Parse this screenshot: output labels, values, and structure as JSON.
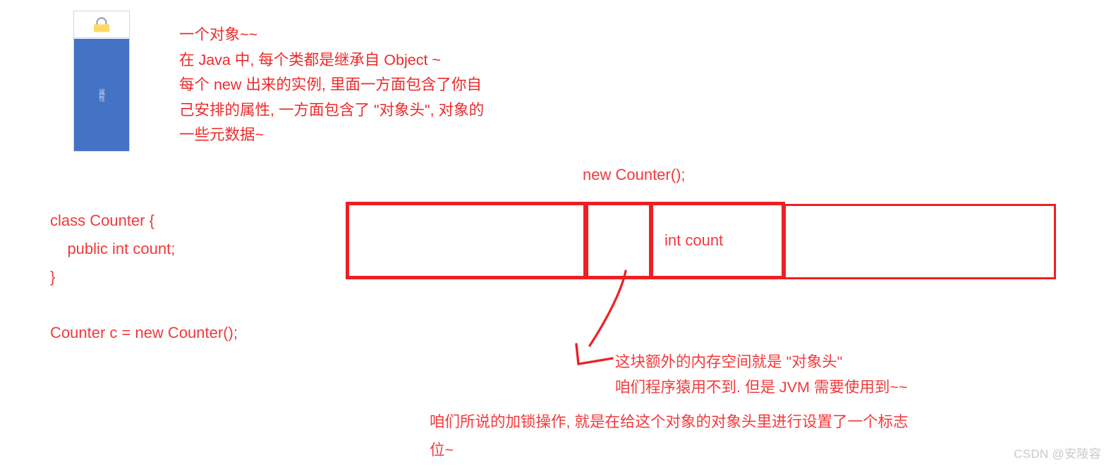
{
  "figure": {
    "lock_icon_name": "padlock-icon",
    "attribute_label": "属性",
    "body_color": "#4472C4",
    "lock_color": "#FFD966"
  },
  "intro_note": {
    "lines": [
      "一个对象~~",
      "在 Java 中, 每个类都是继承自 Object ~",
      "每个 new 出来的实例, 里面一方面包含了你自",
      "己安排的属性, 一方面包含了 \"对象头\", 对象的",
      "一些元数据~"
    ],
    "text": "一个对象~~\n在 Java 中, 每个类都是继承自 Object ~\n每个 new 出来的实例, 里面一方面包含了你自\n己安排的属性, 一方面包含了 \"对象头\", 对象的\n一些元数据~"
  },
  "code": {
    "class_definition": "class Counter {\n    public int count;\n}",
    "usage": "Counter c = new Counter();"
  },
  "memory_diagram": {
    "caption": "new Counter();",
    "accent_color": "#ED2024",
    "cells": [
      {
        "name": "padding-left",
        "label": ""
      },
      {
        "name": "object-header",
        "label": ""
      },
      {
        "name": "int-count",
        "label": "int count"
      },
      {
        "name": "padding-right",
        "label": ""
      }
    ],
    "int_count_label": "int count"
  },
  "notes": {
    "object_header": "这块额外的内存空间就是 \"对象头\"",
    "jvm_usage": "咱们程序猿用不到. 但是 JVM 需要使用到~~",
    "lock_explain": "咱们所说的加锁操作, 就是在给这个对象的对象头里进行设置了一个标志\n位~"
  },
  "watermark": {
    "text": "CSDN @安陵容"
  }
}
